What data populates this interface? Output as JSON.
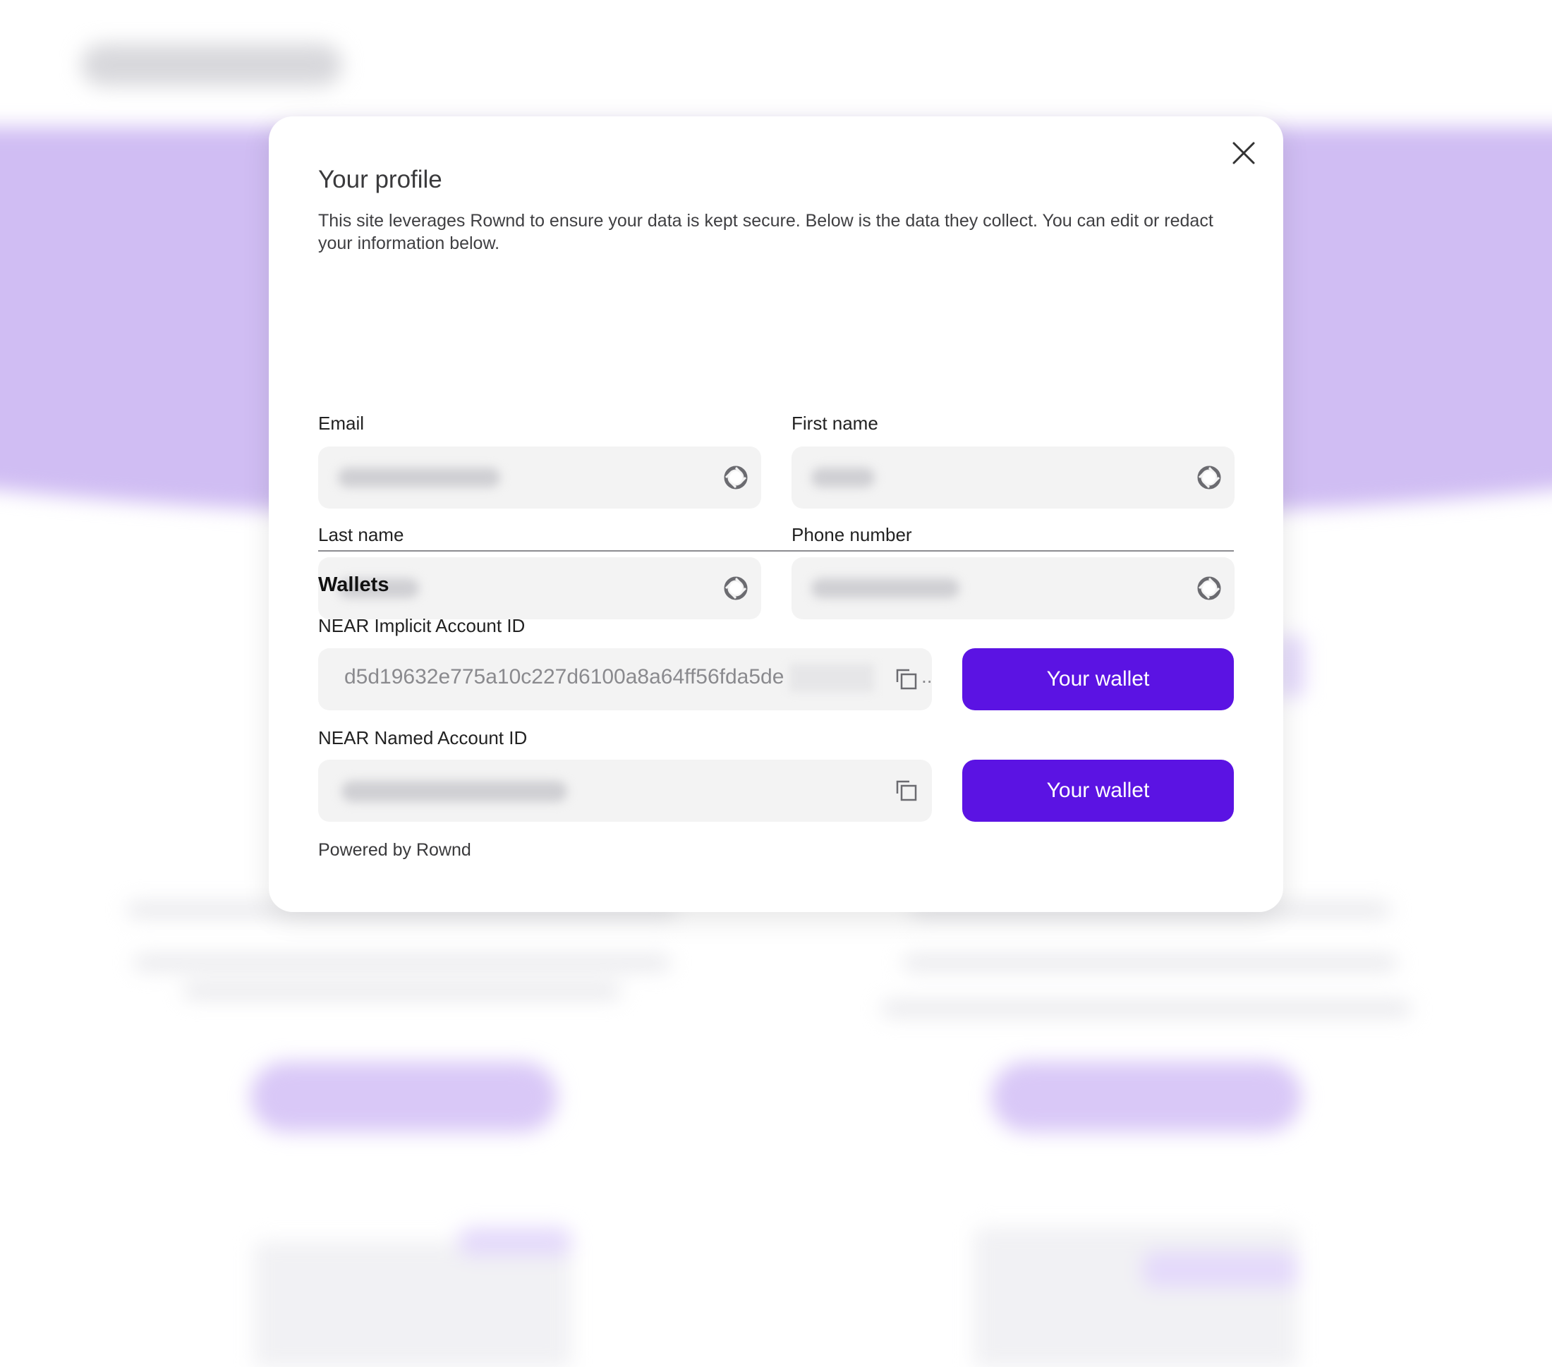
{
  "modal": {
    "title": "Your profile",
    "description": "This site leverages Rownd to ensure your data is kept secure. Below is the data they collect. You can edit or redact your information below.",
    "fields": {
      "email": {
        "label": "Email"
      },
      "first_name": {
        "label": "First name"
      },
      "last_name": {
        "label": "Last name"
      },
      "phone_number": {
        "label": "Phone number"
      }
    },
    "wallets": {
      "heading": "Wallets",
      "implicit": {
        "label": "NEAR Implicit Account ID",
        "value": "d5d19632e775a10c227d6100a8a64ff56fda5de",
        "ellipsis": "..",
        "button_label": "Your wallet"
      },
      "named": {
        "label": "NEAR Named Account ID",
        "button_label": "Your wallet"
      }
    },
    "footer": "Powered by Rownd"
  },
  "icons": {
    "close": "close-icon",
    "redact": "redact-icon",
    "copy": "copy-icon"
  },
  "colors": {
    "accent": "#5b13e3",
    "hero_background": "#d0bdf3",
    "field_background": "#f3f3f3"
  }
}
